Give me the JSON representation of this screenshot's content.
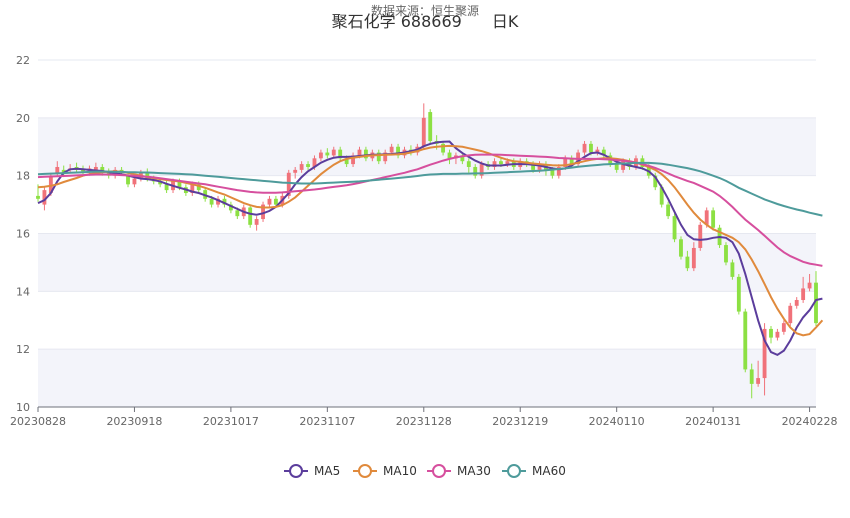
{
  "title": "聚石化学 688669",
  "period": "日K",
  "subtitle": "数据来源：恒生聚源",
  "chart_data": {
    "type": "candlestick",
    "title": "聚石化学 688669 日K",
    "subtitle": "数据来源：恒生聚源",
    "ylim": [
      10,
      22
    ],
    "yticks": [
      10,
      12,
      14,
      16,
      18,
      20,
      22
    ],
    "xtick_labels": [
      "20230828",
      "20230918",
      "20231017",
      "20231107",
      "20231128",
      "20231219",
      "20240110",
      "20240131",
      "20240228"
    ],
    "xtick_index": [
      0,
      15,
      30,
      45,
      60,
      75,
      90,
      105,
      120
    ],
    "up_color": "#f0727a",
    "down_color": "#8ce043",
    "legend_position": "bottom",
    "candles": [
      [
        17.3,
        17.2,
        17.7,
        17.1
      ],
      [
        17.0,
        17.5,
        17.6,
        16.8
      ],
      [
        17.4,
        18.0,
        18.1,
        17.3
      ],
      [
        18.1,
        18.3,
        18.5,
        18.0
      ],
      [
        18.2,
        18.1,
        18.35,
        17.95
      ],
      [
        18.2,
        18.25,
        18.4,
        18.1
      ],
      [
        18.3,
        18.2,
        18.45,
        18.1
      ],
      [
        18.2,
        18.15,
        18.35,
        18.05
      ],
      [
        18.1,
        18.25,
        18.35,
        18.0
      ],
      [
        18.2,
        18.3,
        18.45,
        18.1
      ],
      [
        18.3,
        18.15,
        18.4,
        18.0
      ],
      [
        18.1,
        18.0,
        18.25,
        17.9
      ],
      [
        18.0,
        18.2,
        18.3,
        17.9
      ],
      [
        18.2,
        18.1,
        18.3,
        18.0
      ],
      [
        18.0,
        17.7,
        18.1,
        17.6
      ],
      [
        17.7,
        17.9,
        18.0,
        17.6
      ],
      [
        17.9,
        18.1,
        18.2,
        17.8
      ],
      [
        18.1,
        17.9,
        18.25,
        17.8
      ],
      [
        17.9,
        17.8,
        18.0,
        17.7
      ],
      [
        17.8,
        17.7,
        17.9,
        17.6
      ],
      [
        17.7,
        17.5,
        17.85,
        17.4
      ],
      [
        17.5,
        17.8,
        17.9,
        17.4
      ],
      [
        17.8,
        17.6,
        17.9,
        17.5
      ],
      [
        17.6,
        17.4,
        17.7,
        17.3
      ],
      [
        17.4,
        17.7,
        17.8,
        17.3
      ],
      [
        17.7,
        17.5,
        17.8,
        17.4
      ],
      [
        17.5,
        17.2,
        17.6,
        17.1
      ],
      [
        17.2,
        17.0,
        17.3,
        16.9
      ],
      [
        17.0,
        17.2,
        17.3,
        16.9
      ],
      [
        17.2,
        17.0,
        17.3,
        16.9
      ],
      [
        17.0,
        16.8,
        17.1,
        16.7
      ],
      [
        16.8,
        16.6,
        16.9,
        16.5
      ],
      [
        16.6,
        16.9,
        17.0,
        16.5
      ],
      [
        16.9,
        16.3,
        17.0,
        16.2
      ],
      [
        16.3,
        16.5,
        16.6,
        16.1
      ],
      [
        16.5,
        17.0,
        17.1,
        16.4
      ],
      [
        17.0,
        17.2,
        17.3,
        16.9
      ],
      [
        17.2,
        17.0,
        17.3,
        16.9
      ],
      [
        17.0,
        17.3,
        17.4,
        16.9
      ],
      [
        17.3,
        18.1,
        18.2,
        17.2
      ],
      [
        18.1,
        18.2,
        18.3,
        17.9
      ],
      [
        18.2,
        18.4,
        18.5,
        18.1
      ],
      [
        18.4,
        18.3,
        18.5,
        18.2
      ],
      [
        18.3,
        18.6,
        18.7,
        18.2
      ],
      [
        18.6,
        18.8,
        18.9,
        18.5
      ],
      [
        18.8,
        18.7,
        18.95,
        18.6
      ],
      [
        18.7,
        18.9,
        19.0,
        18.6
      ],
      [
        18.9,
        18.6,
        19.0,
        18.5
      ],
      [
        18.6,
        18.4,
        18.7,
        18.3
      ],
      [
        18.4,
        18.7,
        18.8,
        18.3
      ],
      [
        18.7,
        18.9,
        19.0,
        18.6
      ],
      [
        18.9,
        18.6,
        19.0,
        18.5
      ],
      [
        18.6,
        18.8,
        18.9,
        18.5
      ],
      [
        18.8,
        18.5,
        18.9,
        18.4
      ],
      [
        18.5,
        18.8,
        18.9,
        18.4
      ],
      [
        18.8,
        19.0,
        19.1,
        18.7
      ],
      [
        19.0,
        18.7,
        19.1,
        18.6
      ],
      [
        18.7,
        18.9,
        19.0,
        18.6
      ],
      [
        18.9,
        18.8,
        19.05,
        18.7
      ],
      [
        18.8,
        19.0,
        19.1,
        18.7
      ],
      [
        19.0,
        20.0,
        20.5,
        18.9
      ],
      [
        20.2,
        19.2,
        20.3,
        19.1
      ],
      [
        19.2,
        19.1,
        19.4,
        18.9
      ],
      [
        19.1,
        18.8,
        19.2,
        18.7
      ],
      [
        18.8,
        18.6,
        18.9,
        18.4
      ],
      [
        18.6,
        18.7,
        18.8,
        18.4
      ],
      [
        18.7,
        18.5,
        18.8,
        18.4
      ],
      [
        18.5,
        18.3,
        18.6,
        18.1
      ],
      [
        18.3,
        18.0,
        18.4,
        17.9
      ],
      [
        18.0,
        18.4,
        18.5,
        17.9
      ],
      [
        18.4,
        18.3,
        18.5,
        18.2
      ],
      [
        18.3,
        18.5,
        18.6,
        18.2
      ],
      [
        18.5,
        18.4,
        18.6,
        18.3
      ],
      [
        18.4,
        18.5,
        18.6,
        18.3
      ],
      [
        18.5,
        18.3,
        18.6,
        18.2
      ],
      [
        18.3,
        18.5,
        18.6,
        18.2
      ],
      [
        18.5,
        18.4,
        18.6,
        18.3
      ],
      [
        18.4,
        18.2,
        18.5,
        18.1
      ],
      [
        18.2,
        18.4,
        18.5,
        18.1
      ],
      [
        18.4,
        18.2,
        18.5,
        18.0
      ],
      [
        18.2,
        18.0,
        18.3,
        17.9
      ],
      [
        18.0,
        18.3,
        18.4,
        17.9
      ],
      [
        18.3,
        18.6,
        18.7,
        18.2
      ],
      [
        18.6,
        18.4,
        18.7,
        18.3
      ],
      [
        18.4,
        18.8,
        18.9,
        18.3
      ],
      [
        18.8,
        19.1,
        19.2,
        18.7
      ],
      [
        19.1,
        18.8,
        19.2,
        18.7
      ],
      [
        18.8,
        18.9,
        19.0,
        18.7
      ],
      [
        18.9,
        18.7,
        19.0,
        18.6
      ],
      [
        18.7,
        18.4,
        18.8,
        18.3
      ],
      [
        18.4,
        18.2,
        18.5,
        18.1
      ],
      [
        18.2,
        18.5,
        18.6,
        18.1
      ],
      [
        18.5,
        18.3,
        18.6,
        18.2
      ],
      [
        18.3,
        18.6,
        18.7,
        18.2
      ],
      [
        18.6,
        18.3,
        18.7,
        18.2
      ],
      [
        18.3,
        18.0,
        18.4,
        17.9
      ],
      [
        18.0,
        17.6,
        18.1,
        17.5
      ],
      [
        17.6,
        17.0,
        17.7,
        16.9
      ],
      [
        17.0,
        16.6,
        17.1,
        16.5
      ],
      [
        16.6,
        15.8,
        16.7,
        15.7
      ],
      [
        15.8,
        15.2,
        15.9,
        15.1
      ],
      [
        15.2,
        14.8,
        15.4,
        14.7
      ],
      [
        14.8,
        15.5,
        15.7,
        14.7
      ],
      [
        15.5,
        16.3,
        16.4,
        15.4
      ],
      [
        16.3,
        16.8,
        16.9,
        16.2
      ],
      [
        16.8,
        16.2,
        16.9,
        16.1
      ],
      [
        16.2,
        15.6,
        16.3,
        15.5
      ],
      [
        15.6,
        15.0,
        15.7,
        14.9
      ],
      [
        15.0,
        14.5,
        15.1,
        14.4
      ],
      [
        14.5,
        13.3,
        14.6,
        13.2
      ],
      [
        13.3,
        11.3,
        13.4,
        11.2
      ],
      [
        11.3,
        10.8,
        11.5,
        10.3
      ],
      [
        10.8,
        11.0,
        11.6,
        10.7
      ],
      [
        11.0,
        12.7,
        12.9,
        10.4
      ],
      [
        12.7,
        12.4,
        12.8,
        12.2
      ],
      [
        12.4,
        12.6,
        12.7,
        12.3
      ],
      [
        12.6,
        12.9,
        13.0,
        12.5
      ],
      [
        12.9,
        13.5,
        13.6,
        12.8
      ],
      [
        13.5,
        13.7,
        13.8,
        13.4
      ],
      [
        13.7,
        14.1,
        14.5,
        13.6
      ],
      [
        14.1,
        14.3,
        14.6,
        14.0
      ],
      [
        14.3,
        12.9,
        14.7,
        12.8
      ]
    ],
    "series": [
      {
        "name": "MA5",
        "color": "#5b3d9c",
        "values": [
          17.05,
          17.15,
          17.4,
          17.8,
          18.1,
          18.22,
          18.24,
          18.22,
          18.2,
          18.18,
          18.16,
          18.12,
          18.08,
          18.05,
          18.0,
          17.95,
          17.9,
          17.88,
          17.85,
          17.8,
          17.72,
          17.65,
          17.58,
          17.52,
          17.45,
          17.4,
          17.32,
          17.25,
          17.15,
          17.05,
          16.95,
          16.85,
          16.75,
          16.68,
          16.65,
          16.7,
          16.78,
          16.92,
          17.15,
          17.4,
          17.7,
          17.95,
          18.15,
          18.3,
          18.45,
          18.55,
          18.62,
          18.65,
          18.65,
          18.66,
          18.68,
          18.7,
          18.72,
          18.73,
          18.74,
          18.75,
          18.77,
          18.8,
          18.85,
          18.9,
          19.02,
          19.1,
          19.15,
          19.17,
          19.18,
          18.95,
          18.78,
          18.65,
          18.52,
          18.42,
          18.35,
          18.35,
          18.35,
          18.38,
          18.4,
          18.4,
          18.4,
          18.38,
          18.35,
          18.3,
          18.25,
          18.22,
          18.25,
          18.35,
          18.5,
          18.65,
          18.78,
          18.8,
          18.72,
          18.6,
          18.48,
          18.4,
          18.35,
          18.3,
          18.25,
          18.15,
          17.95,
          17.6,
          17.2,
          16.75,
          16.3,
          15.95,
          15.8,
          15.78,
          15.8,
          15.85,
          15.88,
          15.85,
          15.7,
          15.3,
          14.6,
          13.8,
          13.0,
          12.3,
          11.9,
          11.8,
          11.95,
          12.3,
          12.75,
          13.1,
          13.35,
          13.7,
          13.75
        ]
      },
      {
        "name": "MA10",
        "color": "#e08a3c",
        "values": [
          17.6,
          17.62,
          17.65,
          17.7,
          17.78,
          17.85,
          17.92,
          18.0,
          18.05,
          18.1,
          18.12,
          18.14,
          18.15,
          18.13,
          18.1,
          18.05,
          18.0,
          17.95,
          17.92,
          17.88,
          17.85,
          17.82,
          17.8,
          17.75,
          17.7,
          17.65,
          17.58,
          17.5,
          17.42,
          17.35,
          17.25,
          17.15,
          17.05,
          16.98,
          16.92,
          16.9,
          16.9,
          16.92,
          16.98,
          17.1,
          17.25,
          17.45,
          17.65,
          17.85,
          18.05,
          18.22,
          18.38,
          18.5,
          18.58,
          18.62,
          18.65,
          18.68,
          18.7,
          18.71,
          18.72,
          18.73,
          18.74,
          18.76,
          18.8,
          18.85,
          18.92,
          18.97,
          19.0,
          19.02,
          19.03,
          19.02,
          19.0,
          18.95,
          18.9,
          18.85,
          18.78,
          18.7,
          18.62,
          18.55,
          18.5,
          18.48,
          18.45,
          18.42,
          18.4,
          18.38,
          18.36,
          18.35,
          18.36,
          18.4,
          18.45,
          18.5,
          18.55,
          18.58,
          18.6,
          18.6,
          18.58,
          18.55,
          18.5,
          18.45,
          18.38,
          18.3,
          18.2,
          18.05,
          17.85,
          17.6,
          17.3,
          17.0,
          16.72,
          16.48,
          16.3,
          16.15,
          16.05,
          15.95,
          15.85,
          15.7,
          15.45,
          15.1,
          14.7,
          14.25,
          13.8,
          13.4,
          13.05,
          12.75,
          12.55,
          12.48,
          12.52,
          12.75,
          13.0
        ]
      },
      {
        "name": "MA30",
        "color": "#d64f9e",
        "values": [
          17.95,
          17.96,
          17.97,
          17.98,
          17.99,
          18.0,
          18.01,
          18.02,
          18.03,
          18.04,
          18.04,
          18.04,
          18.03,
          18.02,
          18.01,
          18.0,
          17.98,
          17.96,
          17.94,
          17.91,
          17.88,
          17.85,
          17.82,
          17.79,
          17.76,
          17.73,
          17.7,
          17.66,
          17.62,
          17.58,
          17.54,
          17.5,
          17.47,
          17.44,
          17.42,
          17.41,
          17.41,
          17.41,
          17.42,
          17.44,
          17.46,
          17.48,
          17.5,
          17.52,
          17.55,
          17.58,
          17.61,
          17.64,
          17.67,
          17.71,
          17.75,
          17.8,
          17.85,
          17.9,
          17.95,
          18.0,
          18.05,
          18.1,
          18.16,
          18.22,
          18.3,
          18.38,
          18.45,
          18.52,
          18.58,
          18.63,
          18.67,
          18.7,
          18.72,
          18.73,
          18.73,
          18.73,
          18.72,
          18.71,
          18.7,
          18.69,
          18.68,
          18.67,
          18.66,
          18.65,
          18.63,
          18.61,
          18.6,
          18.59,
          18.58,
          18.58,
          18.58,
          18.58,
          18.57,
          18.56,
          18.54,
          18.52,
          18.49,
          18.45,
          18.4,
          18.34,
          18.27,
          18.18,
          18.08,
          17.98,
          17.9,
          17.82,
          17.75,
          17.65,
          17.55,
          17.45,
          17.3,
          17.12,
          16.92,
          16.7,
          16.48,
          16.3,
          16.12,
          15.92,
          15.72,
          15.52,
          15.35,
          15.22,
          15.12,
          15.02,
          14.96,
          14.92,
          14.88
        ]
      },
      {
        "name": "MA60",
        "color": "#4e9b9b",
        "values": [
          18.05,
          18.06,
          18.07,
          18.08,
          18.09,
          18.1,
          18.11,
          18.12,
          18.13,
          18.14,
          18.14,
          18.14,
          18.13,
          18.13,
          18.12,
          18.12,
          18.11,
          18.11,
          18.1,
          18.09,
          18.08,
          18.07,
          18.06,
          18.05,
          18.04,
          18.02,
          18.0,
          17.98,
          17.96,
          17.94,
          17.92,
          17.9,
          17.88,
          17.86,
          17.84,
          17.82,
          17.8,
          17.78,
          17.76,
          17.75,
          17.74,
          17.73,
          17.73,
          17.73,
          17.74,
          17.75,
          17.76,
          17.77,
          17.78,
          17.79,
          17.8,
          17.82,
          17.84,
          17.86,
          17.88,
          17.9,
          17.92,
          17.94,
          17.96,
          17.99,
          18.02,
          18.04,
          18.05,
          18.06,
          18.06,
          18.06,
          18.07,
          18.07,
          18.08,
          18.08,
          18.09,
          18.1,
          18.11,
          18.12,
          18.13,
          18.14,
          18.15,
          18.16,
          18.17,
          18.19,
          18.21,
          18.23,
          18.25,
          18.28,
          18.31,
          18.33,
          18.35,
          18.37,
          18.39,
          18.4,
          18.41,
          18.42,
          18.43,
          18.44,
          18.44,
          18.44,
          18.43,
          18.41,
          18.38,
          18.34,
          18.3,
          18.26,
          18.21,
          18.15,
          18.08,
          18.0,
          17.92,
          17.82,
          17.7,
          17.58,
          17.48,
          17.38,
          17.28,
          17.18,
          17.1,
          17.02,
          16.95,
          16.89,
          16.83,
          16.78,
          16.72,
          16.67,
          16.62
        ]
      }
    ]
  }
}
